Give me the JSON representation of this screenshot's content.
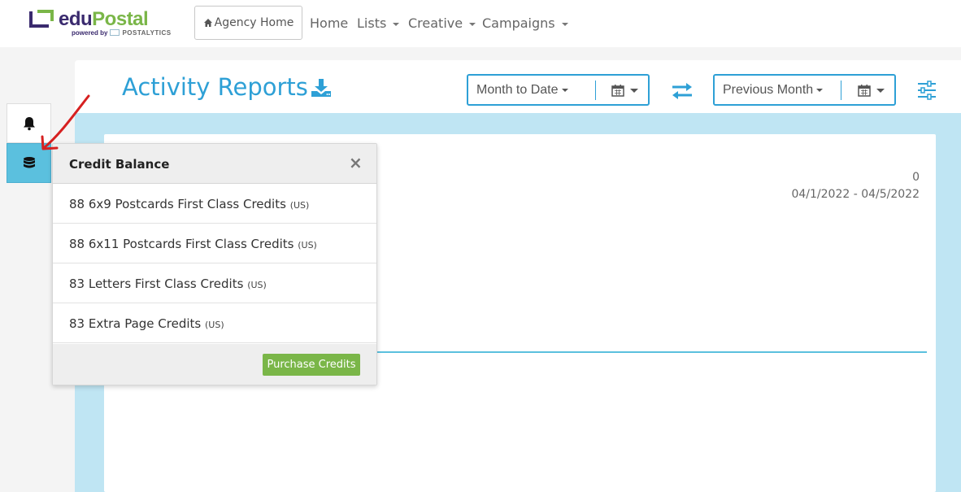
{
  "brand": {
    "name_part1": "edu",
    "name_part2": "Postal",
    "powered_by": "powered by",
    "partner": "POSTALYTICS",
    "colors": {
      "purple": "#3a2a6e",
      "green": "#7ab648"
    }
  },
  "nav": {
    "agency_home": "Agency Home",
    "items": [
      {
        "label": "Home"
      },
      {
        "label": "Lists"
      },
      {
        "label": "Creative"
      },
      {
        "label": "Campaigns"
      }
    ]
  },
  "sidebar": {
    "bell_icon": "bell-icon",
    "credit_icon": "database-icon"
  },
  "page": {
    "title": "Activity Reports",
    "accent": "#2ea0d6"
  },
  "filters": {
    "primary_range": "Month to Date",
    "compare_range": "Previous Month"
  },
  "report": {
    "value": "0",
    "date_range": "04/1/2022 - 04/5/2022"
  },
  "credit_popover": {
    "title": "Credit Balance",
    "close": "×",
    "items": [
      {
        "text": "88 6x9 Postcards First Class Credits",
        "suffix": "(US)"
      },
      {
        "text": "88 6x11 Postcards First Class Credits",
        "suffix": "(US)"
      },
      {
        "text": "83 Letters First Class Credits",
        "suffix": "(US)"
      },
      {
        "text": "83 Extra Page Credits",
        "suffix": "(US)"
      }
    ],
    "purchase_label": "Purchase Credits"
  }
}
